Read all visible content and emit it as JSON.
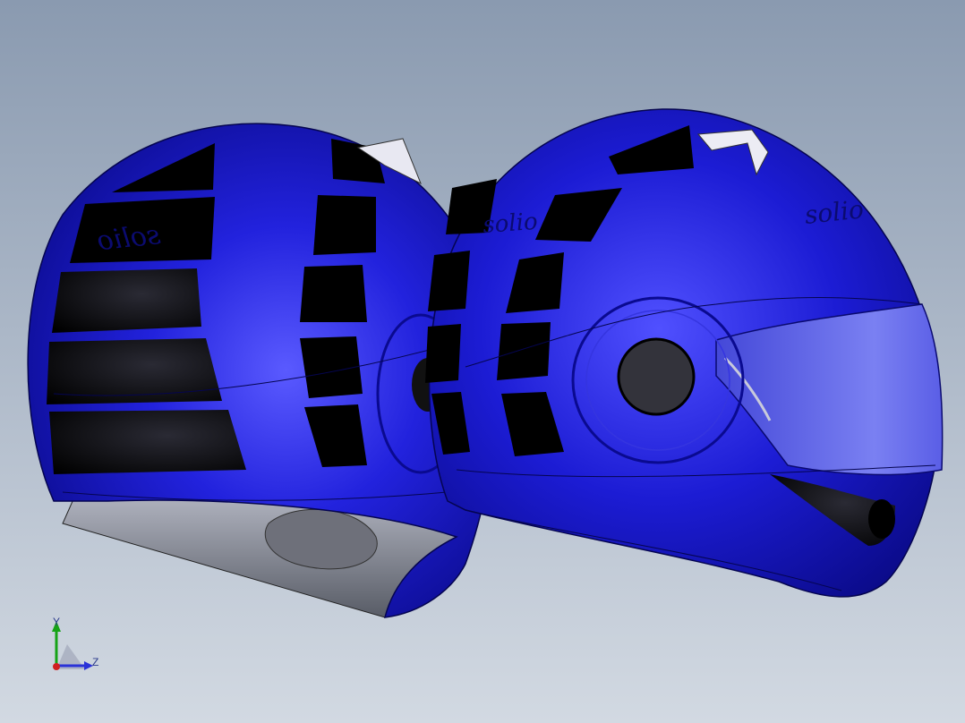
{
  "viewport": {
    "background_top": "#8a9ab0",
    "background_bottom": "#d2d9e2"
  },
  "models": [
    {
      "name": "helmet-rear-view",
      "shell_color": "#1414c8",
      "vent_color": "#000000",
      "logo_text": "solio"
    },
    {
      "name": "helmet-side-view",
      "shell_color": "#1414c8",
      "visor_color": "#6a6ee0",
      "logo_text": "solio",
      "logo_text_2": "solio"
    }
  ],
  "triad": {
    "y_label": "Y",
    "z_label": "Z",
    "y_color": "#16a316",
    "z_color": "#2a32d8",
    "x_color": "#d02020"
  }
}
